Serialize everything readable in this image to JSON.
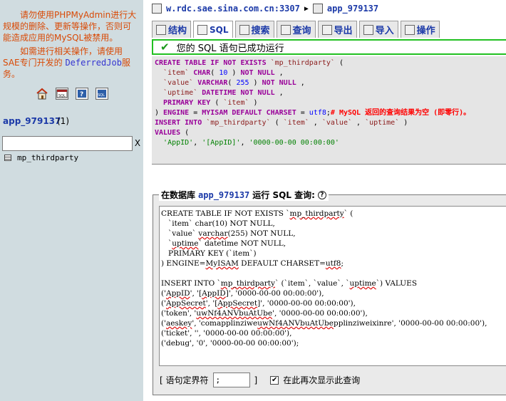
{
  "sidebar": {
    "warning1": {
      "part1": "请勿使用PHPMyAdmin进行大规模的删除、更新等操作，否则可能造成应用的MySQL被禁用。"
    },
    "warning2": {
      "part1": "如需进行相关操作，请使用SAE专门开发的 ",
      "mono": "DeferredJob",
      "part2": "服务。"
    },
    "icons": [
      "home-icon",
      "sql-icon",
      "help-icon",
      "sql-docs-icon"
    ],
    "db_name": "app_979137",
    "db_count": "(1)",
    "filter_placeholder": "",
    "filter_clear": "X",
    "tables": [
      {
        "name": "mp_thirdparty"
      }
    ]
  },
  "breadcrumb": {
    "server": "w.rdc.sae.sina.com.cn:3307",
    "database": "app_979137"
  },
  "tabs": [
    {
      "label": "结构",
      "icon": "structure-icon"
    },
    {
      "label": "SQL",
      "icon": "sql-icon"
    },
    {
      "label": "搜索",
      "icon": "search-icon"
    },
    {
      "label": "查询",
      "icon": "query-icon"
    },
    {
      "label": "导出",
      "icon": "export-icon"
    },
    {
      "label": "导入",
      "icon": "import-icon"
    },
    {
      "label": "操作",
      "icon": "operations-icon"
    }
  ],
  "success_message": "您的 SQL 语句已成功运行",
  "result_sql": [
    "CREATE TABLE IF NOT EXISTS `mp_thirdparty` (",
    "  `item` CHAR( 10 ) NOT NULL ,",
    "  `value` VARCHAR( 255 ) NOT NULL ,",
    "  `uptime` DATETIME NOT NULL ,",
    "  PRIMARY KEY ( `item` )",
    ") ENGINE = MYISAM DEFAULT CHARSET = utf8;# MySQL 返回的查询结果为空 (即零行)。",
    "INSERT INTO `mp_thirdparty` ( `item` , `value` , `uptime` )",
    "VALUES (",
    "  'AppID', '[AppID]', '0000-00-00 00:00:00'"
  ],
  "query_panel": {
    "legend_prefix": "在数据库",
    "database": "app_979137",
    "legend_suffix": "运行 SQL 查询:",
    "editor_text": "CREATE TABLE IF NOT EXISTS `mp_thirdparty` (\n   `item` char(10) NOT NULL,\n   `value` varchar(255) NOT NULL,\n   `uptime` datetime NOT NULL,\n   PRIMARY KEY (`item`)\n) ENGINE=MyISAM DEFAULT CHARSET=utf8;\n\nINSERT INTO `mp_thirdparty` (`item`, `value`, `uptime`) VALUES\n('AppID', '[AppID]', '0000-00-00 00:00:00'),\n('AppSecret', '[AppSecret]', '0000-00-00 00:00:00'),\n('token', 'uwNf4ANVbuAtUbe', '0000-00-00 00:00:00'),\n('aeskey', 'comapplinziweuwNf4ANVbuAtUbepplinziweixinre', '0000-00-00 00:00:00'),\n('ticket', '', '0000-00-00 00:00:00'),\n('debug', '0', '0000-00-00 00:00:00');",
    "delimiter_label_open": "[ 语句定界符",
    "delimiter_value": ";",
    "delimiter_label_close": "]",
    "show_again_label": "在此再次显示此查询",
    "show_again_checked": true
  }
}
